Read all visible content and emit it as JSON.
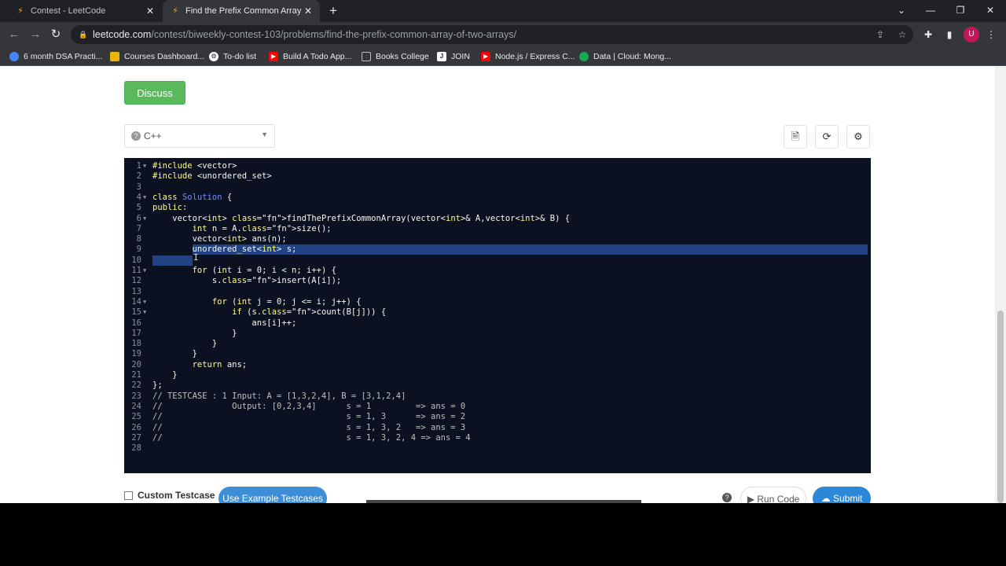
{
  "browser": {
    "tabs": [
      {
        "title": "Contest - LeetCode"
      },
      {
        "title": "Find the Prefix Common Array of"
      }
    ],
    "url_host": "leetcode.com",
    "url_path": "/contest/biweekly-contest-103/problems/find-the-prefix-common-array-of-two-arrays/",
    "avatar_letter": "U",
    "bookmarks": [
      {
        "label": "6 month DSA Practi...",
        "color": "#4285f4"
      },
      {
        "label": "Courses Dashboard...",
        "color": "#e8b600"
      },
      {
        "label": "To-do list",
        "color": "#ffffff"
      },
      {
        "label": "Build A Todo App...",
        "color": "#ff0000"
      },
      {
        "label": "Books College",
        "color": "#5f6368"
      },
      {
        "label": "JOIN",
        "color": "#ffffff"
      },
      {
        "label": "Node.js / Express C...",
        "color": "#ff0000"
      },
      {
        "label": "Data | Cloud: Mong...",
        "color": "#13aa52"
      }
    ]
  },
  "page": {
    "discuss_label": "Discuss",
    "language": "C++",
    "custom_testcase_label": "Custom Testcase",
    "example_label": "Use Example Testcases",
    "run_label": "Run Code",
    "submit_label": "Submit"
  },
  "editor": {
    "selection_lines": [
      9,
      10
    ],
    "lines": [
      "#include <vector>",
      "#include <unordered_set>",
      "",
      "class Solution {",
      "public:",
      "    vector<int> findThePrefixCommonArray(vector<int>& A,vector<int>& B) {",
      "        int n = A.size();",
      "        vector<int> ans(n);",
      "        unordered_set<int> s;",
      "",
      "        for (int i = 0; i < n; i++) {",
      "            s.insert(A[i]);",
      "",
      "            for (int j = 0; j <= i; j++) {",
      "                if (s.count(B[j])) {",
      "                    ans[i]++;",
      "                }",
      "            }",
      "        }",
      "        return ans;",
      "    }",
      "};",
      "// TESTCASE : 1 Input: A = [1,3,2,4], B = [3,1,2,4]",
      "//              Output: [0,2,3,4]      s = 1         => ans = 0",
      "//                                     s = 1, 3      => ans = 2",
      "//                                     s = 1, 3, 2   => ans = 3",
      "//                                     s = 1, 3, 2, 4 => ans = 4",
      ""
    ],
    "fold_lines": [
      1,
      4,
      6,
      11,
      14,
      15
    ]
  }
}
